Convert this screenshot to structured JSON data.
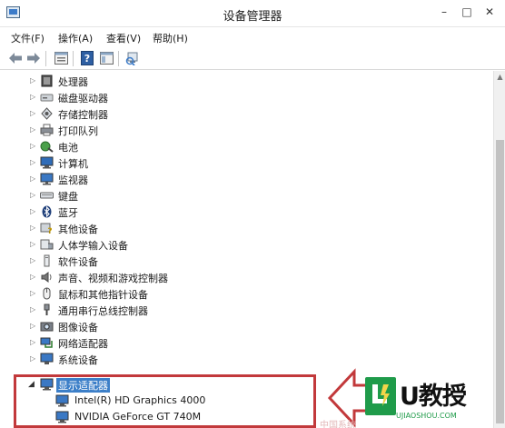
{
  "window": {
    "title": "设备管理器",
    "controls": {
      "minimize": "–",
      "maximize": "□",
      "close": "✕"
    }
  },
  "menubar": {
    "items": [
      "文件(F)",
      "操作(A)",
      "查看(V)",
      "帮助(H)"
    ]
  },
  "toolbar": {
    "buttons": [
      "back-icon",
      "forward-icon",
      "properties-icon",
      "help-icon",
      "view-icon",
      "scan-hardware-icon"
    ]
  },
  "tree": {
    "categories": [
      {
        "label": "处理器",
        "icon": "processor-icon"
      },
      {
        "label": "磁盘驱动器",
        "icon": "disk-drive-icon"
      },
      {
        "label": "存储控制器",
        "icon": "storage-controller-icon"
      },
      {
        "label": "打印队列",
        "icon": "printer-icon"
      },
      {
        "label": "电池",
        "icon": "battery-icon"
      },
      {
        "label": "计算机",
        "icon": "computer-icon"
      },
      {
        "label": "监视器",
        "icon": "monitor-icon"
      },
      {
        "label": "键盘",
        "icon": "keyboard-icon"
      },
      {
        "label": "蓝牙",
        "icon": "bluetooth-icon"
      },
      {
        "label": "其他设备",
        "icon": "other-devices-icon"
      },
      {
        "label": "人体学输入设备",
        "icon": "hid-icon"
      },
      {
        "label": "软件设备",
        "icon": "software-device-icon"
      },
      {
        "label": "声音、视频和游戏控制器",
        "icon": "sound-icon"
      },
      {
        "label": "鼠标和其他指针设备",
        "icon": "mouse-icon"
      },
      {
        "label": "通用串行总线控制器",
        "icon": "usb-icon"
      },
      {
        "label": "图像设备",
        "icon": "imaging-device-icon"
      },
      {
        "label": "网络适配器",
        "icon": "network-adapter-icon"
      },
      {
        "label": "系统设备",
        "icon": "system-device-icon"
      }
    ],
    "display_adapters": {
      "label": "显示适配器",
      "children": [
        "Intel(R) HD Graphics 4000",
        "NVIDIA GeForce GT 740M"
      ]
    }
  },
  "overlay": {
    "badge_text": "U教授",
    "badge_sub": "UJIAOSHOU.COM",
    "watermark": "中国系统",
    "accent": "#c2393b",
    "brand_green": "#1f9b4a",
    "selection_blue": "#3c7fc8"
  }
}
